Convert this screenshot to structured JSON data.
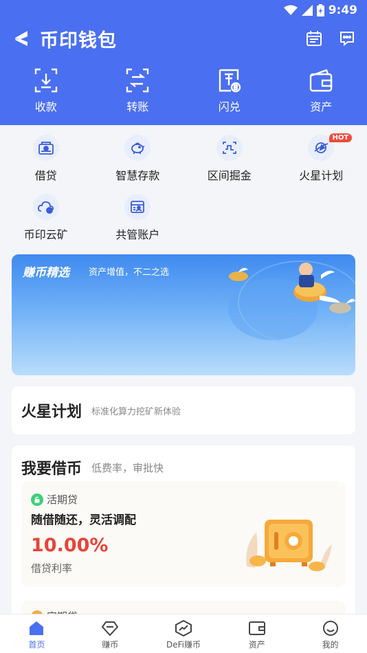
{
  "status_bar": {
    "time": "9:49"
  },
  "header": {
    "app_title": "币印钱包",
    "actions": [
      {
        "label": "收款",
        "icon": "receive-icon"
      },
      {
        "label": "转账",
        "icon": "transfer-icon"
      },
      {
        "label": "闪兑",
        "icon": "flash-swap-icon"
      },
      {
        "label": "资产",
        "icon": "wallet-icon"
      }
    ]
  },
  "features": [
    {
      "label": "借贷",
      "icon": "loan-icon"
    },
    {
      "label": "智慧存款",
      "icon": "piggy-bank-icon"
    },
    {
      "label": "区间掘金",
      "icon": "range-mining-icon"
    },
    {
      "label": "火星计划",
      "icon": "mars-plan-icon",
      "badge": "HOT"
    },
    {
      "label": "币印云矿",
      "icon": "cloud-mining-icon"
    },
    {
      "label": "共管账户",
      "icon": "joint-account-icon"
    }
  ],
  "banner": {
    "title": "赚币精选",
    "subtitle": "资产增值，不二之选"
  },
  "mars_card": {
    "title": "火星计划",
    "subtitle": "标准化算力挖矿新体验"
  },
  "loan_card": {
    "title": "我要借币",
    "subtitle": "低费率，审批快",
    "item": {
      "tag": "活期贷",
      "desc": "随借随还，灵活调配",
      "rate": "10.00%",
      "rate_label": "借贷利率"
    },
    "next_tag": "定期贷"
  },
  "tabs": [
    {
      "label": "首页",
      "icon": "home-icon",
      "active": true
    },
    {
      "label": "赚币",
      "icon": "earn-icon"
    },
    {
      "label": "DeFi赚币",
      "icon": "defi-icon"
    },
    {
      "label": "资产",
      "icon": "assets-icon"
    },
    {
      "label": "我的",
      "icon": "profile-icon"
    }
  ],
  "colors": {
    "primary": "#4a6ff0",
    "rate_red": "#e8443a",
    "hot_badge": "#f04a3e"
  }
}
